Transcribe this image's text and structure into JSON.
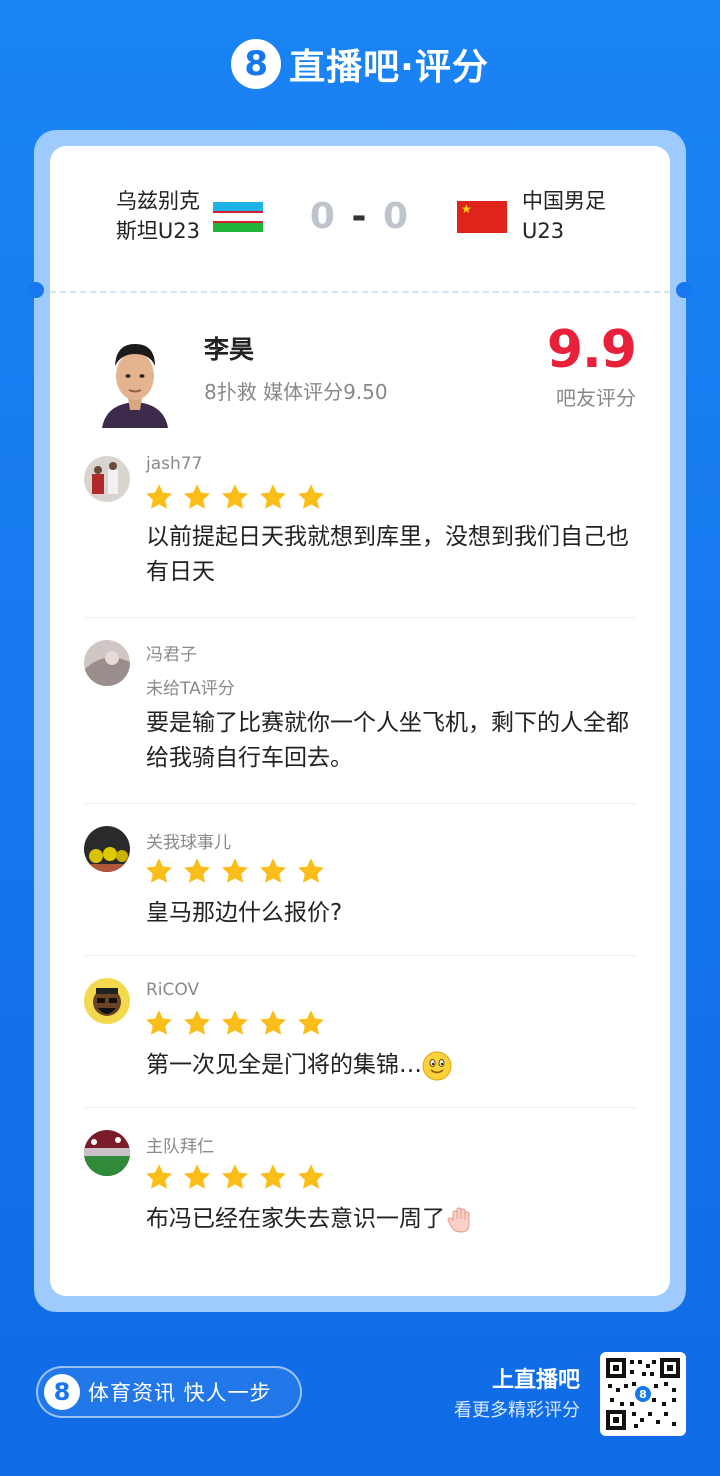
{
  "brand": {
    "logo_glyph": "8",
    "title": "直播吧·评分"
  },
  "match": {
    "home_line1": "乌兹别克",
    "home_line2": "斯坦U23",
    "home_score": "0",
    "separator": "-",
    "away_score": "0",
    "away_line1": "中国男足",
    "away_line2": "U23",
    "home_flag": "uzbekistan-flag",
    "away_flag": "china-flag"
  },
  "player": {
    "name": "李昊",
    "subtitle": "8扑救 媒体评分9.50",
    "rating": "9.9",
    "rating_label": "吧友评分",
    "rating_color": "#e8203a"
  },
  "comments": [
    {
      "user": "jash77",
      "stars": 5,
      "note": "",
      "text": "以前提起日天我就想到库里，没想到我们自己也有日天",
      "emoji": ""
    },
    {
      "user": "冯君子",
      "stars": 0,
      "note": "未给TA评分",
      "text": "要是输了比赛就你一个人坐飞机，剩下的人全都给我骑自行车回去。",
      "emoji": ""
    },
    {
      "user": "关我球事儿",
      "stars": 5,
      "note": "",
      "text": "皇马那边什么报价?",
      "emoji": ""
    },
    {
      "user": "RiCOV",
      "stars": 5,
      "note": "",
      "text": "第一次见全是门将的集锦…",
      "emoji": "smile-emoji"
    },
    {
      "user": "主队拜仁",
      "stars": 5,
      "note": "",
      "text": "布冯已经在家失去意识一周了",
      "emoji": "hand-emoji"
    }
  ],
  "footer": {
    "logo_glyph": "8",
    "slogan": "体育资讯 快人一步",
    "cta_title": "上直播吧",
    "cta_sub": "看更多精彩评分",
    "qr": "qr-code"
  },
  "colors": {
    "accent": "#1677ee",
    "star": "#fbbd18",
    "rating": "#e8203a"
  }
}
